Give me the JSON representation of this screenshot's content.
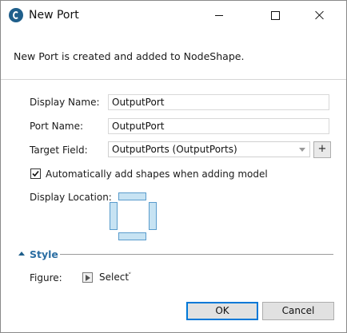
{
  "window": {
    "title": "New Port",
    "icon": "app-logo-icon",
    "controls": [
      "minimize-icon",
      "maximize-icon",
      "close-icon"
    ]
  },
  "message": "New Port is created and added to NodeShape.",
  "form": {
    "display_name_label": "Display Name:",
    "display_name_value": "OutputPort",
    "port_name_label": "Port Name:",
    "port_name_value": "OutputPort",
    "target_field_label": "Target Field:",
    "target_field_value": "OutputPorts (OutputPorts)",
    "add_button_label": "+",
    "auto_add_label": "Automatically add shapes when adding model",
    "auto_add_checked": true,
    "display_location_label": "Display Location:"
  },
  "style": {
    "section_label": "Style",
    "figure_label": "Figure:",
    "figure_value": "Select",
    "figure_chevron": "˅"
  },
  "buttons": {
    "ok": "OK",
    "cancel": "Cancel"
  },
  "colors": {
    "accent": "#2b6ea3",
    "location_fill": "#c7e3f3",
    "location_border": "#5a9ccc",
    "default_button_border": "#0078d7"
  }
}
